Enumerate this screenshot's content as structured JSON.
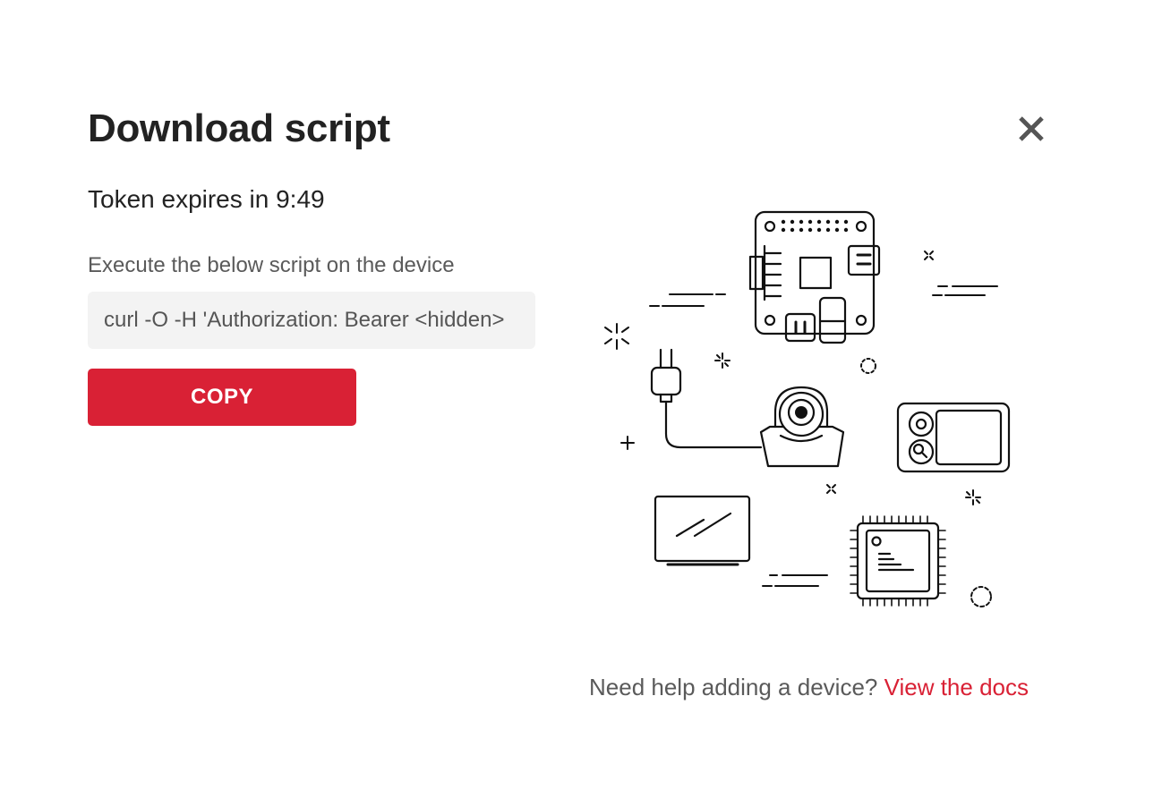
{
  "dialog": {
    "title": "Download script",
    "close_icon": "close-icon"
  },
  "token": {
    "text": "Token expires in 9:49"
  },
  "script": {
    "instruction": "Execute the below script on the device",
    "value": "curl -O -H 'Authorization: Bearer <hidden>"
  },
  "copy_button": {
    "label": "COPY",
    "color": "#d92135"
  },
  "illustration": {
    "icons": [
      "circuit-board-icon",
      "power-plug-icon",
      "camera-icon",
      "device-panel-icon",
      "monitor-icon",
      "microchip-icon"
    ]
  },
  "help": {
    "text": "Need help adding a device?",
    "link_label": "View the docs",
    "link_color": "#d92135"
  }
}
